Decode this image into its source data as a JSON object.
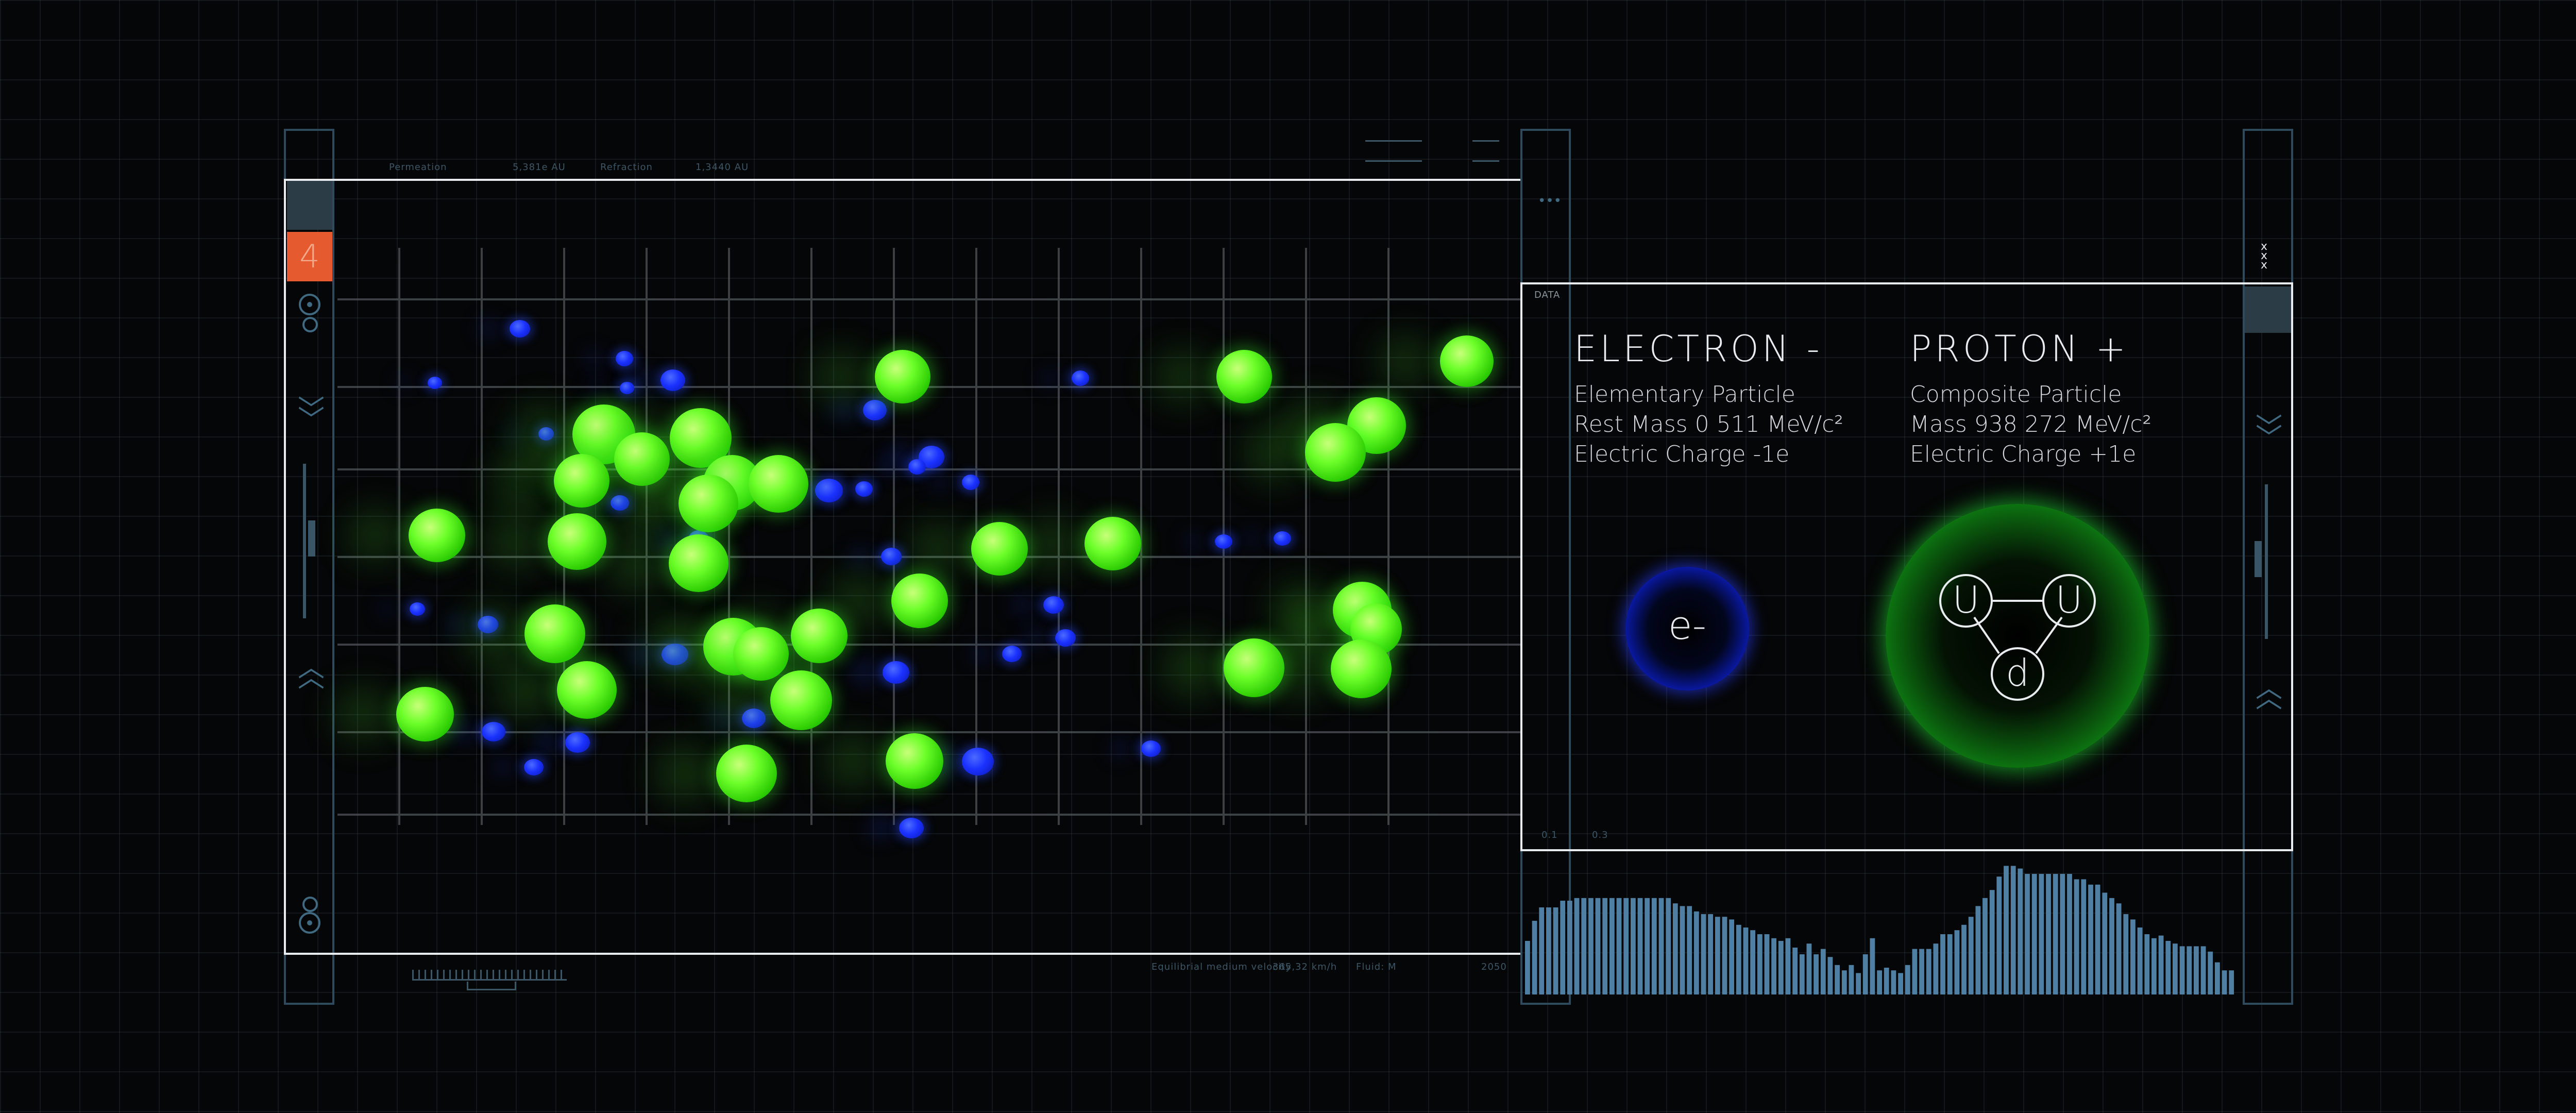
{
  "colors": {
    "background": "#050607",
    "accent_orange": "#e55a2e",
    "rail_blue": "#2f4a5c",
    "particle_green": "#4dff1a",
    "particle_blue": "#1b32ff",
    "frame_white": "#e8ecef"
  },
  "left_panel": {
    "badge_number": "4",
    "header_stats": {
      "label_1": "Permeation",
      "value_1": "5,381e AU",
      "label_2": "Refraction",
      "value_2": "1,3440 AU"
    },
    "footer_stats": {
      "label_1": "Equilibrial medium velocity",
      "value_1": "365,32 km/h",
      "label_2": "Fluid: M",
      "value_2": "2050"
    },
    "icons": [
      "target-icon",
      "chevron-down-icon",
      "chevron-up-icon",
      "target-icon"
    ]
  },
  "right_panel": {
    "tag": "DATA",
    "dots_label": "•••",
    "footer_ticks": [
      "0.1",
      "0.3"
    ],
    "electron": {
      "title": "ELECTRON -",
      "line_1": "Elementary Particle",
      "line_2": "Rest Mass 0 511 MeV/c²",
      "line_3": "Electric Charge -1e",
      "symbol": "e-"
    },
    "proton": {
      "title": "PROTON +",
      "line_1": "Composite Particle",
      "line_2": "Mass 938 272 MeV/c²",
      "line_3": "Electric Charge +1e",
      "quarks": [
        "U",
        "U",
        "d"
      ]
    }
  },
  "histogram": {
    "values": [
      40,
      55,
      65,
      65,
      65,
      70,
      70,
      72,
      72,
      72,
      72,
      72,
      72,
      72,
      72,
      72,
      72,
      72,
      72,
      72,
      72,
      68,
      66,
      66,
      62,
      60,
      60,
      58,
      58,
      56,
      52,
      50,
      48,
      45,
      45,
      42,
      40,
      42,
      35,
      30,
      38,
      30,
      34,
      28,
      22,
      18,
      22,
      16,
      30,
      42,
      18,
      20,
      18,
      16,
      22,
      34,
      34,
      34,
      38,
      45,
      45,
      48,
      52,
      58,
      66,
      72,
      78,
      88,
      96,
      96,
      94,
      90,
      90,
      90,
      90,
      90,
      90,
      90,
      86,
      86,
      82,
      82,
      76,
      72,
      68,
      60,
      56,
      50,
      45,
      42,
      44,
      40,
      38,
      36,
      36,
      36,
      36,
      32,
      24,
      18,
      18
    ]
  }
}
